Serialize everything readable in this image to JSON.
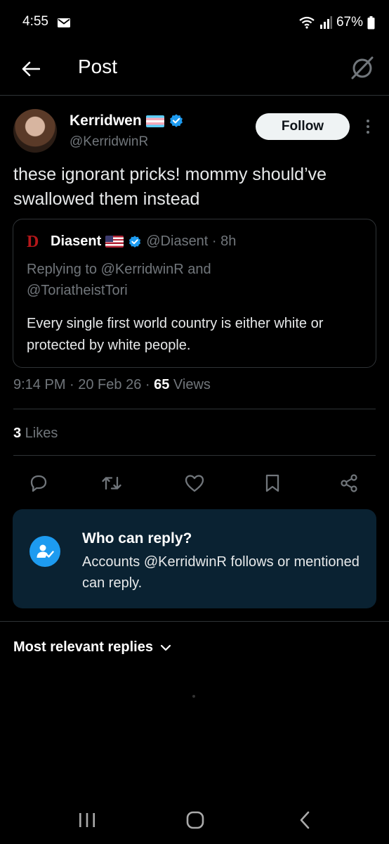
{
  "status_bar": {
    "time": "4:55",
    "battery": "67%"
  },
  "header": {
    "title": "Post"
  },
  "post": {
    "author_name": "Kerridwen",
    "author_handle": "@KerridwinR",
    "follow_label": "Follow",
    "text": "these ignorant pricks!  mommy should’ve swallowed them instead",
    "quote": {
      "logo": "D",
      "name": "Diasent",
      "handle_time": "@Diasent · 8h",
      "reply_prefix": "Replying to ",
      "reply_user1": "@KerridwinR",
      "reply_and": " and",
      "reply_user2": "@ToriatheistTori",
      "text": "Every single first world country is either white or protected by white people."
    },
    "meta_time": "9:14 PM · 20 Feb 26 · ",
    "views_count": "65",
    "views_label": " Views",
    "likes_count": "3",
    "likes_label": " Likes"
  },
  "who_can_reply": {
    "title": "Who can reply?",
    "text": "Accounts @KerridwinR follows or mentioned can reply."
  },
  "replies_sort": {
    "label": "Most relevant replies"
  },
  "colors": {
    "accent": "#1d9bf0",
    "muted": "#71767b",
    "background": "#000000",
    "card": "#0a2232"
  },
  "icons": [
    "mail-icon",
    "wifi-icon",
    "signal-icon",
    "battery-icon",
    "back-arrow-icon",
    "grok-icon",
    "verified-icon",
    "more-icon",
    "reply-icon",
    "repost-icon",
    "like-icon",
    "bookmark-icon",
    "share-icon",
    "user-check-icon",
    "chevron-down-icon",
    "recents-icon",
    "home-icon",
    "back-icon"
  ]
}
